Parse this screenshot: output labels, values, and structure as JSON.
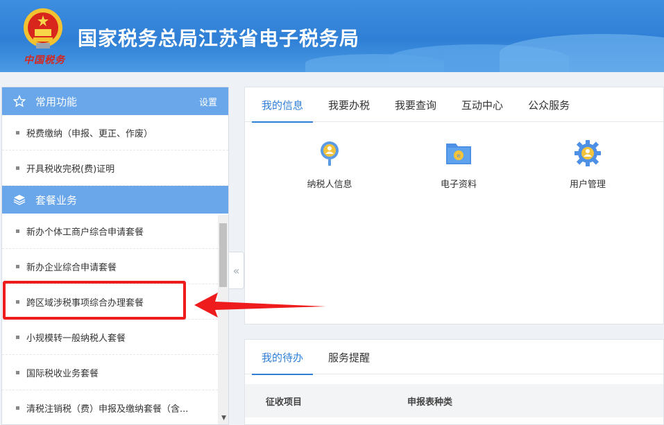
{
  "header": {
    "title": "国家税务总局江苏省电子税务局",
    "brand_script": "中国税务"
  },
  "sidebar": {
    "common_section": {
      "label": "常用功能",
      "settings_label": "设置",
      "icon": "star-icon"
    },
    "common_items": [
      {
        "label": "税费缴纳（申报、更正、作废）"
      },
      {
        "label": "开具税收完税(费)证明"
      }
    ],
    "package_section": {
      "label": "套餐业务",
      "icon": "layers-icon"
    },
    "package_items": [
      {
        "label": "新办个体工商户综合申请套餐"
      },
      {
        "label": "新办企业综合申请套餐"
      },
      {
        "label": "跨区域涉税事项综合办理套餐"
      },
      {
        "label": "小规模转一般纳税人套餐"
      },
      {
        "label": "国际税收业务套餐"
      },
      {
        "label": "清税注销税（费）申报及缴纳套餐（含..."
      }
    ]
  },
  "main": {
    "tabs": [
      {
        "label": "我的信息"
      },
      {
        "label": "我要办税"
      },
      {
        "label": "我要查询"
      },
      {
        "label": "互动中心"
      },
      {
        "label": "公众服务"
      }
    ],
    "tiles": [
      {
        "label": "纳税人信息",
        "icon": "taxpayer-info-icon"
      },
      {
        "label": "电子资料",
        "icon": "folder-icon"
      },
      {
        "label": "用户管理",
        "icon": "gear-user-icon"
      }
    ],
    "todo_tabs": [
      {
        "label": "我的待办"
      },
      {
        "label": "服务提醒"
      }
    ],
    "table_headers": [
      "征收项目",
      "申报表种类"
    ]
  },
  "colors": {
    "header_blue": "#3d8ee0",
    "accent": "#2f7fd6",
    "section_blue": "#6aa7ea",
    "highlight_red": "#ee1c1c"
  }
}
